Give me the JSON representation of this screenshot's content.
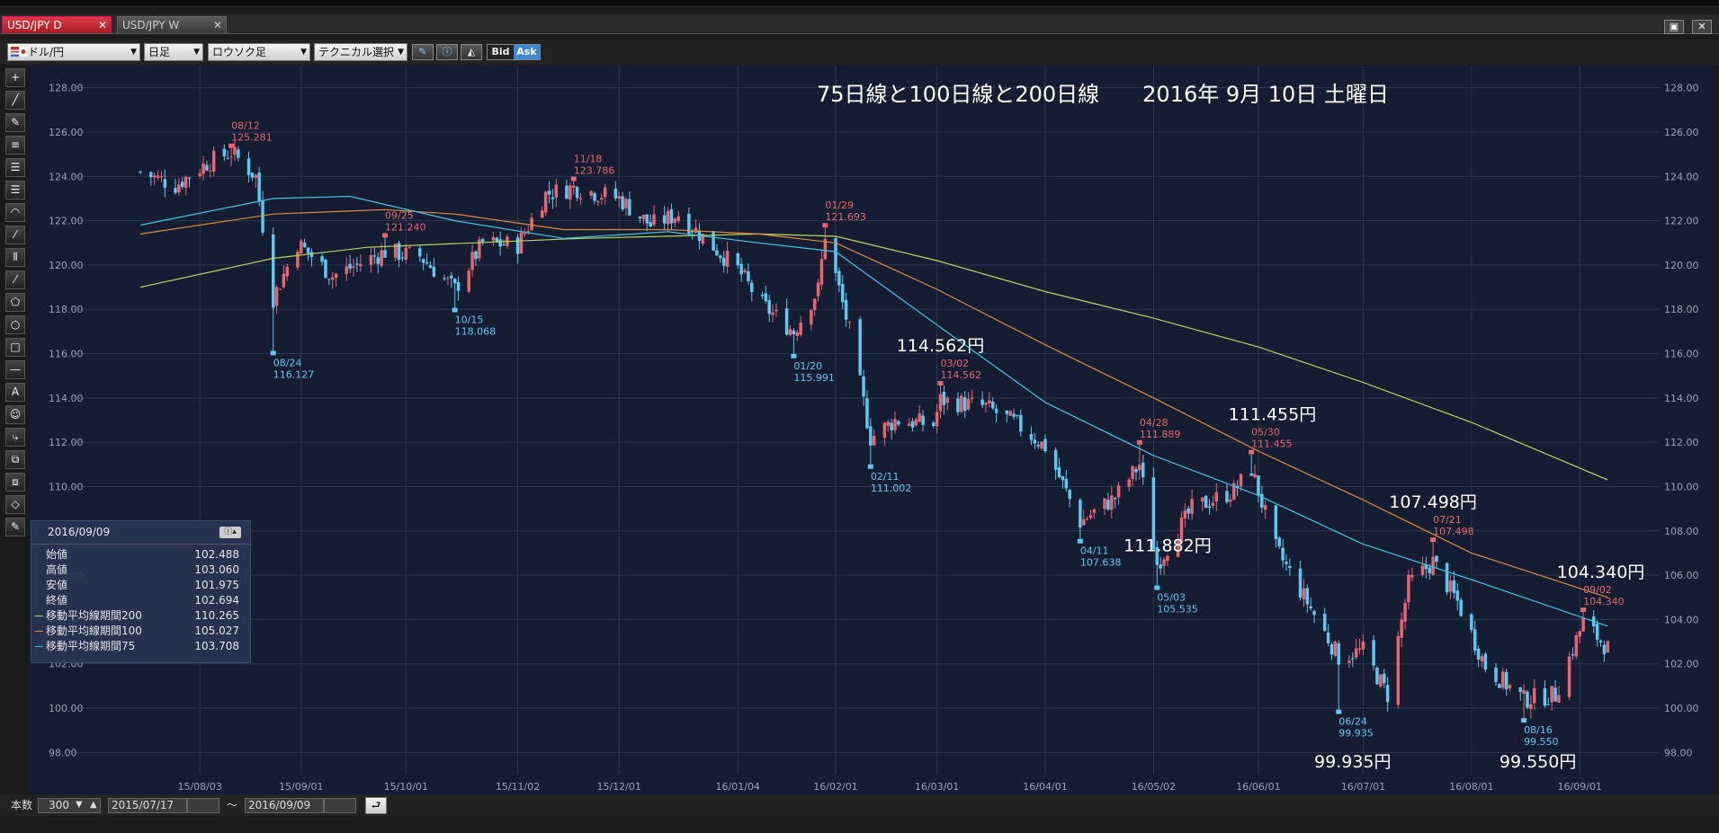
{
  "tabs": [
    {
      "label": "USD/JPY D",
      "close": "✕"
    },
    {
      "label": "USD/JPY W",
      "close": "✕"
    }
  ],
  "window_buttons": [
    "▣",
    "✕"
  ],
  "toolbar": {
    "pair": "ドル/円",
    "timeframe": "日足",
    "chart_style": "ロウソク足",
    "technical": "テクニカル選択",
    "bid": "Bid",
    "ask": "Ask"
  },
  "side_tools": [
    "+",
    "╱",
    "✎",
    "≡",
    "☰",
    "☰",
    "◠",
    "⁄",
    "⦀",
    "⁄",
    "⬠",
    "○",
    "□",
    "—",
    "A",
    "☺",
    "⤷",
    "⧉",
    "⧈",
    "◇",
    "✎"
  ],
  "info_panel": {
    "date": "2016/09/09",
    "rows": [
      {
        "label": "始値",
        "value": "102.488"
      },
      {
        "label": "高値",
        "value": "103.060"
      },
      {
        "label": "安値",
        "value": "101.975"
      },
      {
        "label": "終値",
        "value": "102.694"
      },
      {
        "label": "移動平均線期間200",
        "value": "110.265",
        "color": "#b8d65c"
      },
      {
        "label": "移動平均線期間100",
        "value": "105.027",
        "color": "#e08a3c"
      },
      {
        "label": "移動平均線期間75",
        "value": "103.708",
        "color": "#3ec6e0"
      }
    ]
  },
  "bottom_bar": {
    "count_label": "本数",
    "count_value": "300",
    "from_date": "2015/07/17",
    "tilde": "〜",
    "to_date": "2016/09/09",
    "go": "⮐"
  },
  "chart_data": {
    "type": "candlestick",
    "title": "75日線と100日線と200日線　　2016年 9月 10日 土曜日",
    "ylim": [
      97,
      129
    ],
    "y_ticks": [
      "128.00",
      "126.00",
      "124.00",
      "122.00",
      "120.00",
      "118.00",
      "116.00",
      "114.00",
      "112.00",
      "110.00",
      "108.00",
      "106.00",
      "104.00",
      "102.00",
      "100.00",
      "98.00"
    ],
    "x_ticks": [
      "15/08/03",
      "15/09/01",
      "15/10/01",
      "15/11/02",
      "15/12/01",
      "16/01/04",
      "16/02/01",
      "16/03/01",
      "16/04/01",
      "16/05/02",
      "16/06/01",
      "16/07/01",
      "16/08/01",
      "16/09/01"
    ],
    "colors": {
      "up": "#e8656f",
      "down": "#5ec8f2",
      "ma200": "#b8d65c",
      "ma100": "#e08a3c",
      "ma75": "#3ec6e0",
      "grid": "#2c3752"
    },
    "anchors": [
      [
        "2015-07-17",
        124.2
      ],
      [
        "2015-07-27",
        123.6
      ],
      [
        "2015-08-05",
        124.6
      ],
      [
        "2015-08-12",
        125.1
      ],
      [
        "2015-08-19",
        124.0
      ],
      [
        "2015-08-24",
        118.5
      ],
      [
        "2015-08-31",
        121.0
      ],
      [
        "2015-09-10",
        119.5
      ],
      [
        "2015-09-25",
        120.6
      ],
      [
        "2015-10-05",
        120.4
      ],
      [
        "2015-10-15",
        118.9
      ],
      [
        "2015-10-23",
        121.0
      ],
      [
        "2015-11-02",
        120.9
      ],
      [
        "2015-11-10",
        123.2
      ],
      [
        "2015-11-18",
        123.5
      ],
      [
        "2015-12-01",
        123.0
      ],
      [
        "2015-12-10",
        121.8
      ],
      [
        "2015-12-18",
        122.3
      ],
      [
        "2016-01-04",
        119.8
      ],
      [
        "2016-01-11",
        118.2
      ],
      [
        "2016-01-20",
        117.0
      ],
      [
        "2016-01-27",
        118.9
      ],
      [
        "2016-01-29",
        121.4
      ],
      [
        "2016-02-05",
        117.0
      ],
      [
        "2016-02-11",
        112.2
      ],
      [
        "2016-02-18",
        113.0
      ],
      [
        "2016-02-29",
        112.8
      ],
      [
        "2016-03-02",
        113.9
      ],
      [
        "2016-03-15",
        113.6
      ],
      [
        "2016-03-24",
        112.8
      ],
      [
        "2016-04-01",
        111.8
      ],
      [
        "2016-04-11",
        108.4
      ],
      [
        "2016-04-21",
        109.5
      ],
      [
        "2016-04-28",
        111.0
      ],
      [
        "2016-05-03",
        106.5
      ],
      [
        "2016-05-13",
        109.0
      ],
      [
        "2016-05-25",
        109.8
      ],
      [
        "2016-05-30",
        110.8
      ],
      [
        "2016-06-06",
        107.2
      ],
      [
        "2016-06-16",
        104.5
      ],
      [
        "2016-06-24",
        102.3
      ],
      [
        "2016-07-01",
        102.6
      ],
      [
        "2016-07-08",
        100.6
      ],
      [
        "2016-07-14",
        105.6
      ],
      [
        "2016-07-21",
        106.6
      ],
      [
        "2016-07-28",
        104.8
      ],
      [
        "2016-08-05",
        101.9
      ],
      [
        "2016-08-16",
        100.4
      ],
      [
        "2016-08-25",
        100.6
      ],
      [
        "2016-09-02",
        103.9
      ],
      [
        "2016-09-09",
        102.7
      ]
    ],
    "moving_averages": {
      "ma200": [
        [
          "2015-07-17",
          119.0
        ],
        [
          "2015-08-24",
          120.3
        ],
        [
          "2015-09-20",
          120.8
        ],
        [
          "2015-11-20",
          121.2
        ],
        [
          "2016-01-10",
          121.4
        ],
        [
          "2016-02-01",
          121.3
        ],
        [
          "2016-03-01",
          120.2
        ],
        [
          "2016-04-01",
          118.8
        ],
        [
          "2016-05-02",
          117.6
        ],
        [
          "2016-06-01",
          116.3
        ],
        [
          "2016-07-01",
          114.7
        ],
        [
          "2016-08-01",
          112.9
        ],
        [
          "2016-09-09",
          110.3
        ]
      ],
      "ma100": [
        [
          "2015-07-17",
          121.4
        ],
        [
          "2015-08-24",
          122.3
        ],
        [
          "2015-09-25",
          122.5
        ],
        [
          "2015-10-15",
          122.3
        ],
        [
          "2015-11-15",
          121.6
        ],
        [
          "2015-12-15",
          121.6
        ],
        [
          "2016-01-10",
          121.4
        ],
        [
          "2016-02-01",
          121.0
        ],
        [
          "2016-03-01",
          118.9
        ],
        [
          "2016-04-01",
          116.4
        ],
        [
          "2016-05-02",
          114.0
        ],
        [
          "2016-06-01",
          111.6
        ],
        [
          "2016-07-01",
          109.4
        ],
        [
          "2016-08-01",
          107.0
        ],
        [
          "2016-09-09",
          105.0
        ]
      ],
      "ma75": [
        [
          "2015-07-17",
          121.8
        ],
        [
          "2015-08-24",
          123.0
        ],
        [
          "2015-09-15",
          123.1
        ],
        [
          "2015-10-15",
          122.0
        ],
        [
          "2015-11-15",
          121.2
        ],
        [
          "2015-12-15",
          121.5
        ],
        [
          "2016-01-10",
          121.0
        ],
        [
          "2016-02-01",
          120.6
        ],
        [
          "2016-03-01",
          117.3
        ],
        [
          "2016-04-01",
          113.8
        ],
        [
          "2016-05-02",
          111.4
        ],
        [
          "2016-06-01",
          109.6
        ],
        [
          "2016-07-01",
          107.4
        ],
        [
          "2016-08-01",
          105.8
        ],
        [
          "2016-09-09",
          103.7
        ]
      ]
    },
    "swing_labels": [
      {
        "date": "2015-08-12",
        "price": 125.281,
        "label": "08/12",
        "value": "125.281",
        "kind": "high"
      },
      {
        "date": "2015-08-24",
        "price": 116.127,
        "label": "08/24",
        "value": "116.127",
        "kind": "low"
      },
      {
        "date": "2015-09-25",
        "price": 121.24,
        "label": "09/25",
        "value": "121.240",
        "kind": "high"
      },
      {
        "date": "2015-10-15",
        "price": 118.068,
        "label": "10/15",
        "value": "118.068",
        "kind": "low"
      },
      {
        "date": "2015-11-18",
        "price": 123.786,
        "label": "11/18",
        "value": "123.786",
        "kind": "high"
      },
      {
        "date": "2016-01-20",
        "price": 115.991,
        "label": "01/20",
        "value": "115.991",
        "kind": "low"
      },
      {
        "date": "2016-01-29",
        "price": 121.693,
        "label": "01/29",
        "value": "121.693",
        "kind": "high"
      },
      {
        "date": "2016-02-11",
        "price": 111.002,
        "label": "02/11",
        "value": "111.002",
        "kind": "low"
      },
      {
        "date": "2016-03-02",
        "price": 114.562,
        "label": "03/02",
        "value": "114.562",
        "kind": "high"
      },
      {
        "date": "2016-04-11",
        "price": 107.638,
        "label": "04/11",
        "value": "107.638",
        "kind": "low"
      },
      {
        "date": "2016-04-28",
        "price": 111.889,
        "label": "04/28",
        "value": "111.889",
        "kind": "high"
      },
      {
        "date": "2016-05-03",
        "price": 105.535,
        "label": "05/03",
        "value": "105.535",
        "kind": "low"
      },
      {
        "date": "2016-05-30",
        "price": 111.455,
        "label": "05/30",
        "value": "111.455",
        "kind": "high"
      },
      {
        "date": "2016-06-24",
        "price": 99.935,
        "label": "06/24",
        "value": "99.935",
        "kind": "low"
      },
      {
        "date": "2016-07-21",
        "price": 107.498,
        "label": "07/21",
        "value": "107.498",
        "kind": "high"
      },
      {
        "date": "2016-08-16",
        "price": 99.55,
        "label": "08/16",
        "value": "99.550",
        "kind": "low"
      },
      {
        "date": "2016-09-02",
        "price": 104.34,
        "label": "09/02",
        "value": "104.340",
        "kind": "high"
      }
    ],
    "annotations": [
      {
        "text": "114.562円",
        "date": "2016-03-02",
        "anchor": "above"
      },
      {
        "text": "111.882円",
        "date": "2016-05-06",
        "anchor": "above"
      },
      {
        "text": "111.455円",
        "date": "2016-06-05",
        "anchor": "above"
      },
      {
        "text": "107.498円",
        "date": "2016-07-21",
        "anchor": "above"
      },
      {
        "text": "104.340円",
        "date": "2016-09-07",
        "anchor": "above"
      },
      {
        "text": "99.935円",
        "date": "2016-06-28",
        "anchor": "below"
      },
      {
        "text": "99.550円",
        "date": "2016-08-20",
        "anchor": "below"
      }
    ]
  }
}
